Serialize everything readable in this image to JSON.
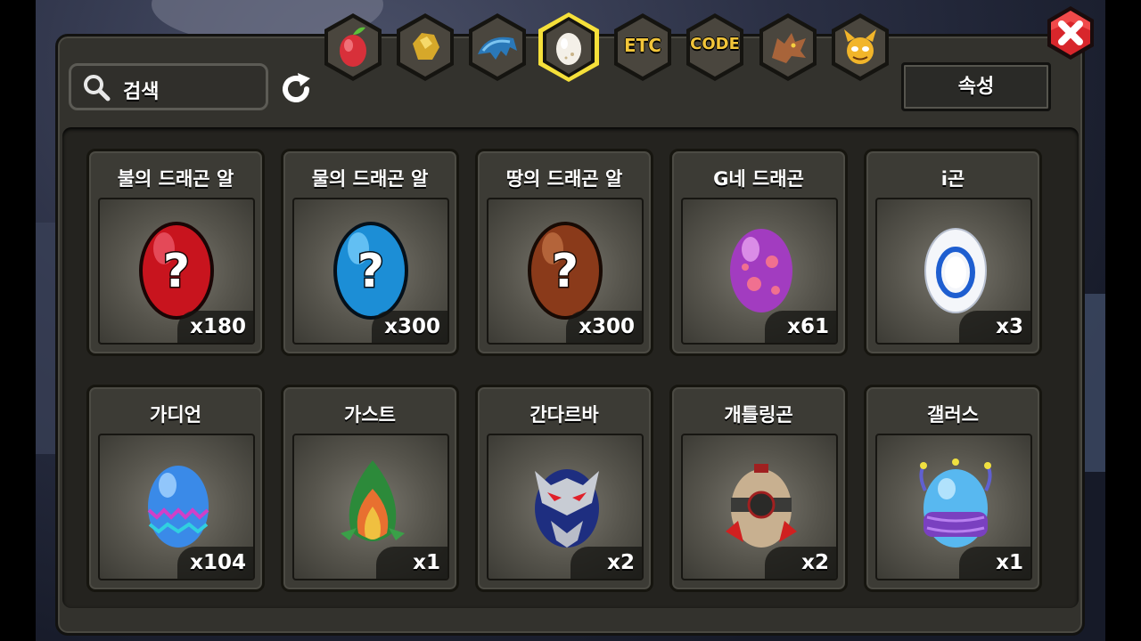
{
  "search": {
    "placeholder": "검색"
  },
  "attribute_button": "속성",
  "tabs": [
    {
      "icon": "fruit-icon",
      "label": ""
    },
    {
      "icon": "gold-ore-icon",
      "label": ""
    },
    {
      "icon": "dragon-wing-icon",
      "label": ""
    },
    {
      "icon": "egg-icon",
      "label": "",
      "selected": true
    },
    {
      "icon": "etc-text-icon",
      "label": "ETC"
    },
    {
      "icon": "code-text-icon",
      "label": "CODE"
    },
    {
      "icon": "dragon-head-icon",
      "label": ""
    },
    {
      "icon": "demon-face-icon",
      "label": ""
    }
  ],
  "eggs": [
    {
      "name": "불의 드래곤 알",
      "qty": "x180",
      "icon": "red-mystery-egg-icon"
    },
    {
      "name": "물의 드래곤 알",
      "qty": "x300",
      "icon": "blue-mystery-egg-icon"
    },
    {
      "name": "땅의 드래곤 알",
      "qty": "x300",
      "icon": "brown-mystery-egg-icon"
    },
    {
      "name": "G네 드래곤",
      "qty": "x61",
      "icon": "purple-spotted-egg-icon"
    },
    {
      "name": "i곤",
      "qty": "x3",
      "icon": "white-ring-egg-icon"
    },
    {
      "name": "가디언",
      "qty": "x104",
      "icon": "blue-pattern-egg-icon"
    },
    {
      "name": "가스트",
      "qty": "x1",
      "icon": "leaf-egg-icon"
    },
    {
      "name": "간다르바",
      "qty": "x2",
      "icon": "masked-egg-icon"
    },
    {
      "name": "개틀링곤",
      "qty": "x2",
      "icon": "mechanical-egg-icon"
    },
    {
      "name": "갤러스",
      "qty": "x1",
      "icon": "purple-banded-egg-icon"
    }
  ],
  "colors": {
    "panel": "#33322d",
    "tab_gold": "#f2c53a",
    "selected_tab_border": "#f5e03a",
    "close_red": "#d8262b"
  }
}
